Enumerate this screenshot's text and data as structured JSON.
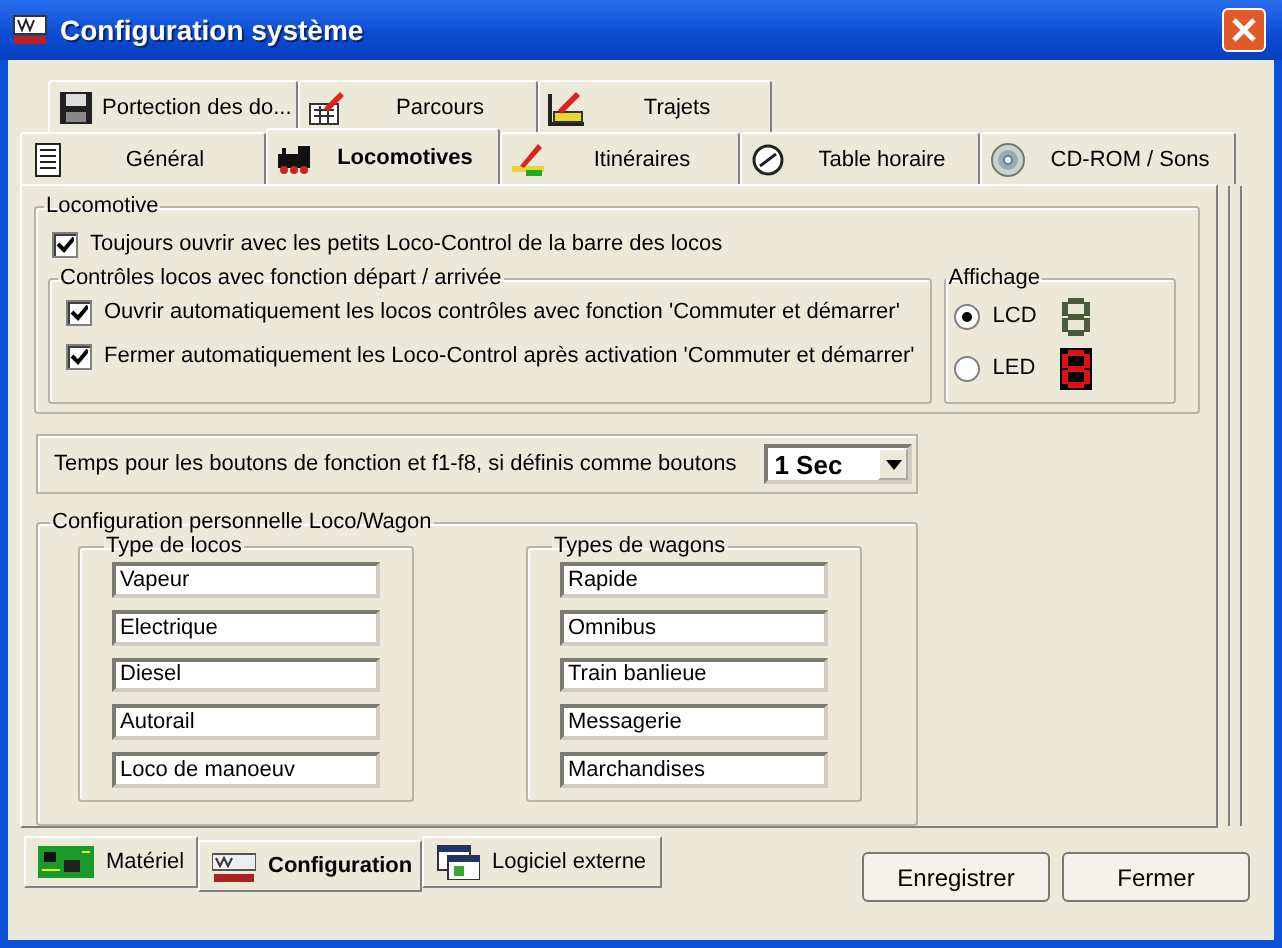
{
  "window": {
    "title": "Configuration système"
  },
  "tab_rows": [
    [
      {
        "label": "Portection des do...",
        "selected": false
      },
      {
        "label": "Parcours",
        "selected": false
      },
      {
        "label": "Trajets",
        "selected": false
      }
    ],
    [
      {
        "label": "Général",
        "selected": false
      },
      {
        "label": "Locomotives",
        "selected": true
      },
      {
        "label": "Itinéraires",
        "selected": false
      },
      {
        "label": "Table horaire",
        "selected": false
      },
      {
        "label": "CD-ROM / Sons",
        "selected": false
      }
    ]
  ],
  "locomotive": {
    "title": "Locomotive",
    "option": {
      "label": "Toujours ouvrir avec les petits Loco-Control de la barre des locos",
      "checked": true
    },
    "controls": {
      "title": "Contrôles locos avec fonction départ / arrivée",
      "options": [
        {
          "label": "Ouvrir automatiquement les locos contrôles avec fonction 'Commuter et démarrer'",
          "checked": true
        },
        {
          "label": "Fermer automatiquement les Loco-Control après activation 'Commuter et démarrer'",
          "checked": true
        }
      ]
    },
    "display": {
      "title": "Affichage",
      "options": [
        {
          "label": "LCD",
          "kind": "lcd",
          "selected": true
        },
        {
          "label": "LED",
          "kind": "led",
          "selected": false
        }
      ]
    }
  },
  "timing": {
    "label": "Temps pour les boutons de fonction et f1-f8, si définis comme boutons",
    "value": "1 Sec"
  },
  "personal": {
    "title": "Configuration personnelle Loco/Wagon",
    "groups": [
      {
        "title": "Type de locos",
        "fields": [
          "Vapeur",
          "Electrique",
          "Diesel",
          "Autorail",
          "Loco de manoeuv"
        ]
      },
      {
        "title": "Types de wagons",
        "fields": [
          "Rapide",
          "Omnibus",
          "Train banlieue",
          "Messagerie",
          "Marchandises"
        ]
      }
    ]
  },
  "bottom_tabs": [
    {
      "label": "Matériel",
      "selected": false
    },
    {
      "label": "Configuration",
      "selected": true
    },
    {
      "label": "Logiciel externe",
      "selected": false
    }
  ],
  "buttons": [
    "Enregistrer",
    "Fermer"
  ]
}
